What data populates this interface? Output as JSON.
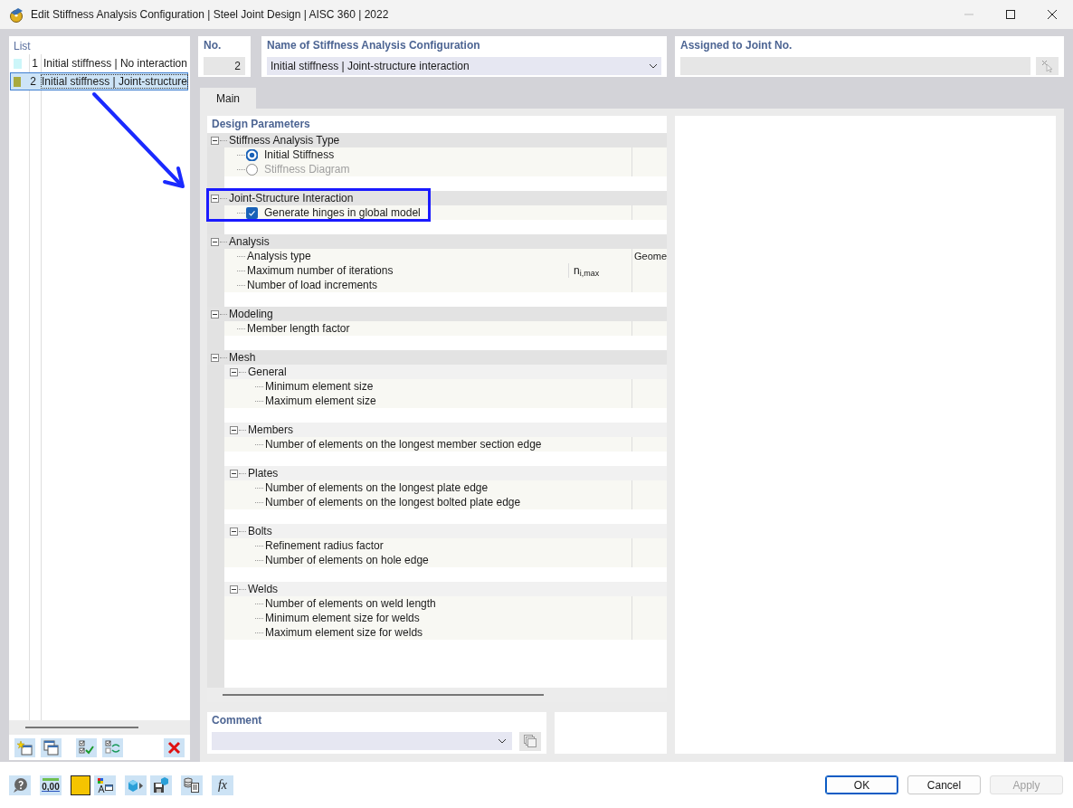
{
  "window": {
    "title": "Edit Stiffness Analysis Configuration | Steel Joint Design | AISC 360 | 2022"
  },
  "list": {
    "title": "List",
    "items": [
      {
        "number": "1",
        "name": "Initial stiffness | No interaction",
        "color": "#ccf6f9",
        "selected": false
      },
      {
        "number": "2",
        "name": "Initial stiffness | Joint-structure",
        "color": "#a9aa3f",
        "selected": true
      }
    ]
  },
  "no_field": {
    "label": "No.",
    "value": "2"
  },
  "name_field": {
    "label": "Name of Stiffness Analysis Configuration",
    "value": "Initial stiffness | Joint-structure interaction"
  },
  "assigned_field": {
    "label": "Assigned to Joint No."
  },
  "tabs": [
    {
      "label": "Main",
      "selected": true
    }
  ],
  "tree": {
    "title": "Design Parameters",
    "sections": [
      {
        "label": "Stiffness Analysis Type",
        "expanded": true,
        "highlighted": false,
        "children": [
          {
            "kind": "radio",
            "label": "Initial Stiffness",
            "selected": true,
            "disabled": false
          },
          {
            "kind": "radio",
            "label": "Stiffness Diagram",
            "selected": false,
            "disabled": true
          }
        ]
      },
      {
        "label": "Joint-Structure Interaction",
        "expanded": true,
        "highlighted": true,
        "children": [
          {
            "kind": "checkbox",
            "label": "Generate hinges in global model",
            "checked": true
          }
        ]
      },
      {
        "label": "Analysis",
        "expanded": true,
        "highlighted": false,
        "children": [
          {
            "kind": "param",
            "label": "Analysis type",
            "value": "Geome"
          },
          {
            "kind": "param",
            "label": "Maximum number of iterations",
            "symbol": "n$_{i,max}$"
          },
          {
            "kind": "param",
            "label": "Number of load increments"
          }
        ]
      },
      {
        "label": "Modeling",
        "expanded": true,
        "highlighted": false,
        "children": [
          {
            "kind": "param",
            "label": "Member length factor"
          }
        ]
      },
      {
        "label": "Mesh",
        "expanded": true,
        "highlighted": false,
        "children": [
          {
            "kind": "group",
            "label": "General",
            "expanded": true,
            "children": [
              {
                "kind": "param",
                "label": "Minimum element size"
              },
              {
                "kind": "param",
                "label": "Maximum element size"
              }
            ]
          },
          {
            "kind": "group",
            "label": "Members",
            "expanded": true,
            "children": [
              {
                "kind": "param",
                "label": "Number of elements on the longest member section edge"
              }
            ]
          },
          {
            "kind": "group",
            "label": "Plates",
            "expanded": true,
            "children": [
              {
                "kind": "param",
                "label": "Number of elements on the longest plate edge"
              },
              {
                "kind": "param",
                "label": "Number of elements on the longest bolted plate edge"
              }
            ]
          },
          {
            "kind": "group",
            "label": "Bolts",
            "expanded": true,
            "children": [
              {
                "kind": "param",
                "label": "Refinement radius factor"
              },
              {
                "kind": "param",
                "label": "Number of elements on hole edge"
              }
            ]
          },
          {
            "kind": "group",
            "label": "Welds",
            "expanded": true,
            "children": [
              {
                "kind": "param",
                "label": "Number of elements on weld length"
              },
              {
                "kind": "param",
                "label": "Minimum element size for welds"
              },
              {
                "kind": "param",
                "label": "Maximum element size for welds"
              }
            ]
          }
        ]
      }
    ]
  },
  "comment": {
    "label": "Comment"
  },
  "footer": {
    "units_icon_text": "0,00",
    "formula_icon_text": "fx",
    "buttons": [
      {
        "label": "OK",
        "default": true,
        "disabled": false
      },
      {
        "label": "Cancel",
        "default": false,
        "disabled": false
      },
      {
        "label": "Apply",
        "default": false,
        "disabled": true
      }
    ]
  }
}
